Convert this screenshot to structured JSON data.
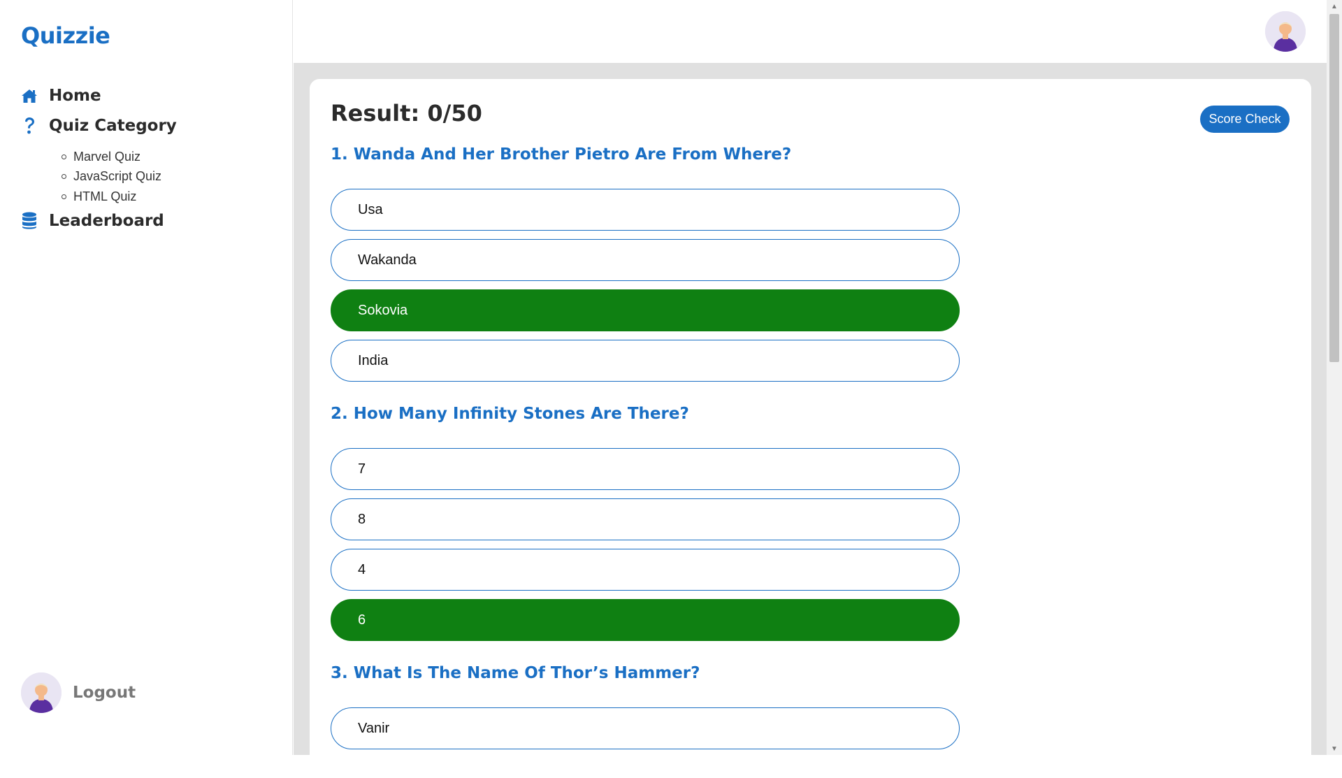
{
  "sidebar": {
    "brand": "Quizzie",
    "nav": {
      "home": "Home",
      "quiz_category": "Quiz Category",
      "leaderboard": "Leaderboard"
    },
    "categories": [
      "Marvel Quiz",
      "JavaScript Quiz",
      "HTML Quiz"
    ],
    "logout": "Logout"
  },
  "main": {
    "result": "Result: 0/50",
    "score_check": "Score Check",
    "questions": [
      {
        "title": "1. Wanda And Her Brother Pietro Are From Where?",
        "options": [
          "Usa",
          "Wakanda",
          "Sokovia",
          "India"
        ],
        "correct_index": 2
      },
      {
        "title": "2. How Many Infinity Stones Are There?",
        "options": [
          "7",
          "8",
          "4",
          "6"
        ],
        "correct_index": 3
      },
      {
        "title": "3. What Is The Name Of Thor’s Hammer?",
        "options": [
          "Vanir"
        ]
      }
    ]
  },
  "colors": {
    "brand": "#1a6fc4",
    "correct": "#0f8012",
    "content_bg": "#e0e0e0"
  },
  "icons": {
    "home": "home-icon",
    "quiz_category": "question-mark-icon",
    "leaderboard": "database-icon",
    "avatar": "user-avatar-icon"
  }
}
